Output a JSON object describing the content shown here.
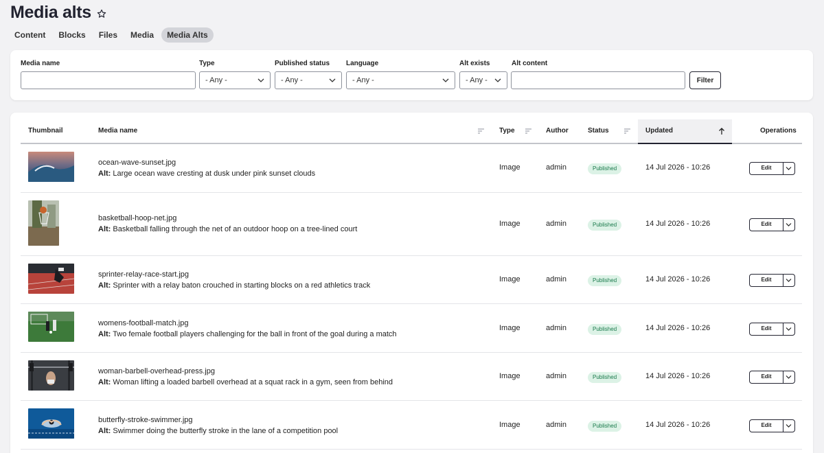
{
  "page": {
    "title": "Media alts"
  },
  "tabs": [
    {
      "label": "Content",
      "active": false
    },
    {
      "label": "Blocks",
      "active": false
    },
    {
      "label": "Files",
      "active": false
    },
    {
      "label": "Media",
      "active": false
    },
    {
      "label": "Media Alts",
      "active": true
    }
  ],
  "filters": {
    "media_name_label": "Media name",
    "media_name_value": "",
    "type_label": "Type",
    "type_value": "- Any -",
    "published_label": "Published status",
    "published_value": "- Any -",
    "language_label": "Language",
    "language_value": "- Any -",
    "alt_exists_label": "Alt exists",
    "alt_exists_value": "- Any -",
    "alt_content_label": "Alt content",
    "alt_content_value": "",
    "filter_button": "Filter"
  },
  "table": {
    "headers": {
      "thumbnail": "Thumbnail",
      "media_name": "Media name",
      "type": "Type",
      "author": "Author",
      "status": "Status",
      "updated": "Updated",
      "operations": "Operations"
    },
    "alt_prefix": "Alt:",
    "edit_label": "Edit",
    "rows": [
      {
        "name": "ocean-wave-sunset.jpg",
        "alt": "Large ocean wave cresting at dusk under pink sunset clouds",
        "type": "Image",
        "author": "admin",
        "status": "Published",
        "updated": "14 Jul 2026 - 10:26"
      },
      {
        "name": "basketball-hoop-net.jpg",
        "alt": "Basketball falling through the net of an outdoor hoop on a tree-lined court",
        "type": "Image",
        "author": "admin",
        "status": "Published",
        "updated": "14 Jul 2026 - 10:26"
      },
      {
        "name": "sprinter-relay-race-start.jpg",
        "alt": "Sprinter with a relay baton crouched in starting blocks on a red athletics track",
        "type": "Image",
        "author": "admin",
        "status": "Published",
        "updated": "14 Jul 2026 - 10:26"
      },
      {
        "name": "womens-football-match.jpg",
        "alt": "Two female football players challenging for the ball in front of the goal during a match",
        "type": "Image",
        "author": "admin",
        "status": "Published",
        "updated": "14 Jul 2026 - 10:26"
      },
      {
        "name": "woman-barbell-overhead-press.jpg",
        "alt": "Woman lifting a loaded barbell overhead at a squat rack in a gym, seen from behind",
        "type": "Image",
        "author": "admin",
        "status": "Published",
        "updated": "14 Jul 2026 - 10:26"
      },
      {
        "name": "butterfly-stroke-swimmer.jpg",
        "alt": "Swimmer doing the butterfly stroke in the lane of a competition pool",
        "type": "Image",
        "author": "admin",
        "status": "Published",
        "updated": "14 Jul 2026 - 10:26"
      }
    ]
  },
  "colors": {
    "accent_dark": "#222330",
    "badge_bg": "#dcf2e6",
    "badge_text": "#1a7a4c",
    "page_bg": "#f2f2f4"
  }
}
